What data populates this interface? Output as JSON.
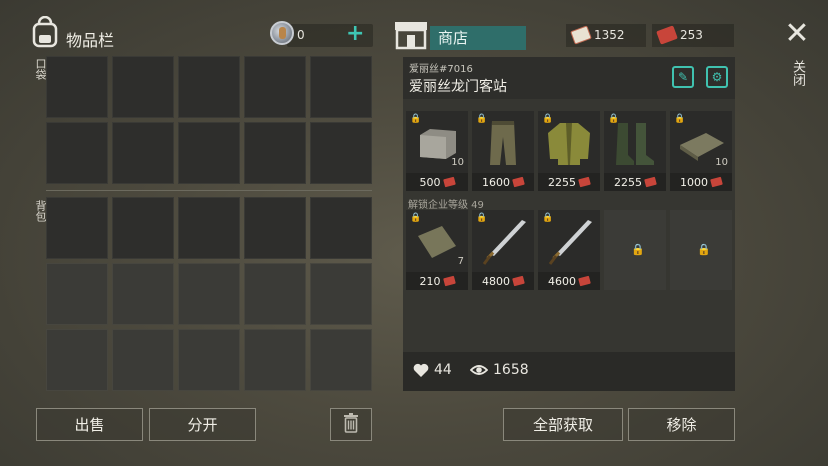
{
  "inventory": {
    "title": "物品栏",
    "coin_value": "0",
    "plus_label": "+",
    "pocket_label": "口袋",
    "backpack_label": "背包",
    "sell_button": "出售",
    "split_button": "分开"
  },
  "shop": {
    "tab_label": "商店",
    "currency_1": "1352",
    "currency_2": "253",
    "owner": "爱丽丝#7016",
    "name": "爱丽丝龙门客站",
    "unlock_label": "解锁企业等级 49",
    "items_row1": [
      {
        "price": "500",
        "qty": "10"
      },
      {
        "price": "1600",
        "qty": ""
      },
      {
        "price": "2255",
        "qty": ""
      },
      {
        "price": "2255",
        "qty": ""
      },
      {
        "price": "1000",
        "qty": "10"
      }
    ],
    "items_row2": [
      {
        "price": "210",
        "qty": "7"
      },
      {
        "price": "4800",
        "qty": ""
      },
      {
        "price": "4600",
        "qty": ""
      }
    ],
    "likes": "44",
    "views": "1658",
    "take_all_button": "全部获取",
    "remove_button": "移除"
  },
  "close_label": "关闭",
  "colors": {
    "accent": "#3ec6b4",
    "shop_tab": "#2f6e6a",
    "ticket": "#c8453a"
  }
}
